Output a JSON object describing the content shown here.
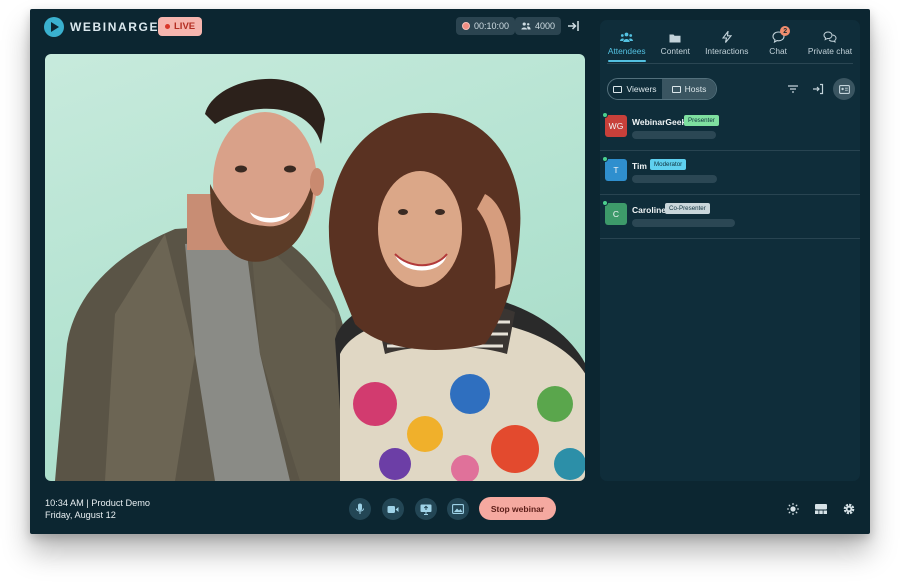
{
  "app": {
    "logo_text": "WEBINARGEEK",
    "live_label": "LIVE",
    "timer": "00:10:00",
    "attendee_count": "4000"
  },
  "panel": {
    "tabs": [
      {
        "label": "Attendees",
        "icon": "attendees-icon",
        "active": true
      },
      {
        "label": "Content",
        "icon": "folder-icon",
        "active": false
      },
      {
        "label": "Interactions",
        "icon": "lightning-icon",
        "active": false
      },
      {
        "label": "Chat",
        "icon": "chat-icon",
        "active": false,
        "badge": "2"
      },
      {
        "label": "Private chat",
        "icon": "private-chat-icon",
        "active": false
      }
    ],
    "segment": {
      "viewers": "Viewers",
      "hosts": "Hosts",
      "selected": "Hosts"
    },
    "hosts": [
      {
        "initials": "WG",
        "name": "WebinarGeek",
        "role": "Presenter",
        "avatar_color": "#c8403a",
        "badge_color": "#7fe0a0"
      },
      {
        "initials": "T",
        "name": "Tim",
        "role": "Moderator",
        "avatar_color": "#2f8fce",
        "badge_color": "#5fd0ef"
      },
      {
        "initials": "C",
        "name": "Caroline",
        "role": "Co-Presenter",
        "avatar_color": "#3d9a6a",
        "badge_color": "#c9d6db"
      }
    ]
  },
  "bottom": {
    "time_title": "10:34 AM | Product Demo",
    "date": "Friday, August 12",
    "stop_label": "Stop webinar"
  },
  "colors": {
    "background": "#0c2631",
    "accent": "#53c1e1",
    "stop": "#f5a9a0"
  }
}
